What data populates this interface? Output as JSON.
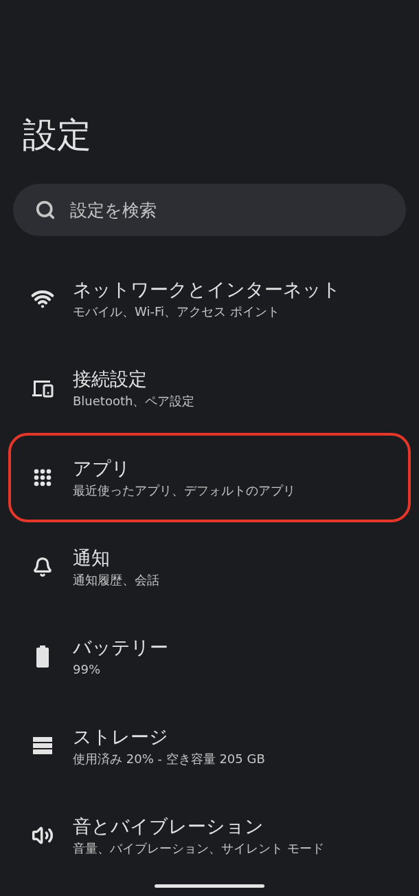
{
  "title": "設定",
  "search": {
    "placeholder": "設定を検索"
  },
  "items": [
    {
      "kind": "wifi",
      "title": "ネットワークとインターネット",
      "subtitle": "モバイル、Wi-Fi、アクセス ポイント",
      "highlighted": false
    },
    {
      "kind": "devices",
      "title": "接続設定",
      "subtitle": "Bluetooth、ペア設定",
      "highlighted": false
    },
    {
      "kind": "apps",
      "title": "アプリ",
      "subtitle": "最近使ったアプリ、デフォルトのアプリ",
      "highlighted": true
    },
    {
      "kind": "bell",
      "title": "通知",
      "subtitle": "通知履歴、会話",
      "highlighted": false
    },
    {
      "kind": "battery",
      "title": "バッテリー",
      "subtitle": "99%",
      "highlighted": false
    },
    {
      "kind": "storage",
      "title": "ストレージ",
      "subtitle": "使用済み 20% - 空き容量 205 GB",
      "highlighted": false
    },
    {
      "kind": "sound",
      "title": "音とバイブレーション",
      "subtitle": "音量、バイブレーション、サイレント モード",
      "highlighted": false
    }
  ]
}
